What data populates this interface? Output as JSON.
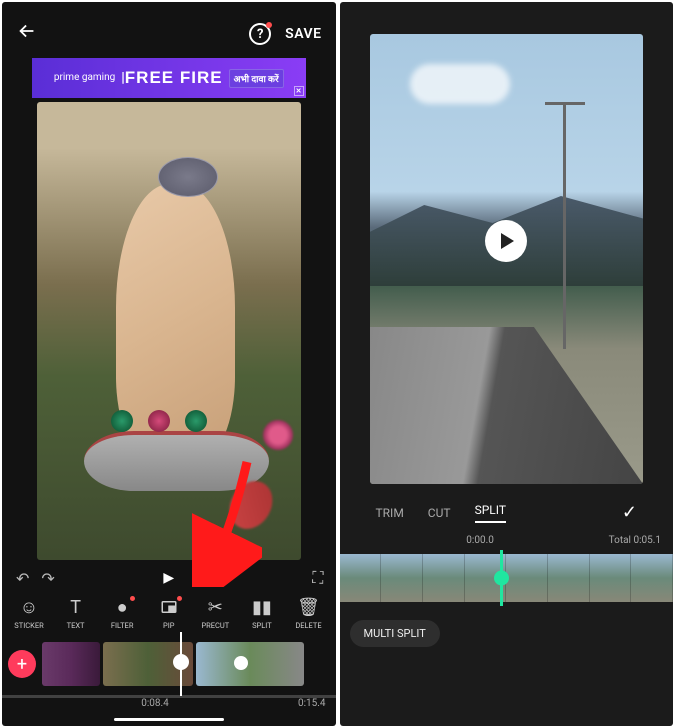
{
  "left": {
    "save_label": "SAVE",
    "help_glyph": "?",
    "ad": {
      "prime": "prime gaming",
      "title": "FREE FIRE",
      "badge": "अभी दावा करें"
    },
    "tools": [
      {
        "label": "STICKER",
        "icon": "☺"
      },
      {
        "label": "TEXT",
        "icon": "T"
      },
      {
        "label": "FILTER",
        "icon": "●",
        "dot": true
      },
      {
        "label": "PIP",
        "icon": "pip",
        "dot": true
      },
      {
        "label": "PRECUT",
        "icon": "✂"
      },
      {
        "label": "SPLIT",
        "icon": "▮▮"
      },
      {
        "label": "DELETE",
        "icon": "🗑"
      }
    ],
    "play_glyph": "▶",
    "undo_glyph": "↶",
    "redo_glyph": "↷",
    "fullscreen_glyph": "⛶",
    "add_glyph": "+",
    "time_current": "0:08.4",
    "time_total": "0:15.4"
  },
  "right": {
    "tabs": [
      "TRIM",
      "CUT",
      "SPLIT"
    ],
    "active_tab": "SPLIT",
    "confirm_glyph": "✓",
    "time_current": "0:00.0",
    "time_total_label": "Total 0:05.1",
    "multi_split_label": "MULTI SPLIT"
  }
}
